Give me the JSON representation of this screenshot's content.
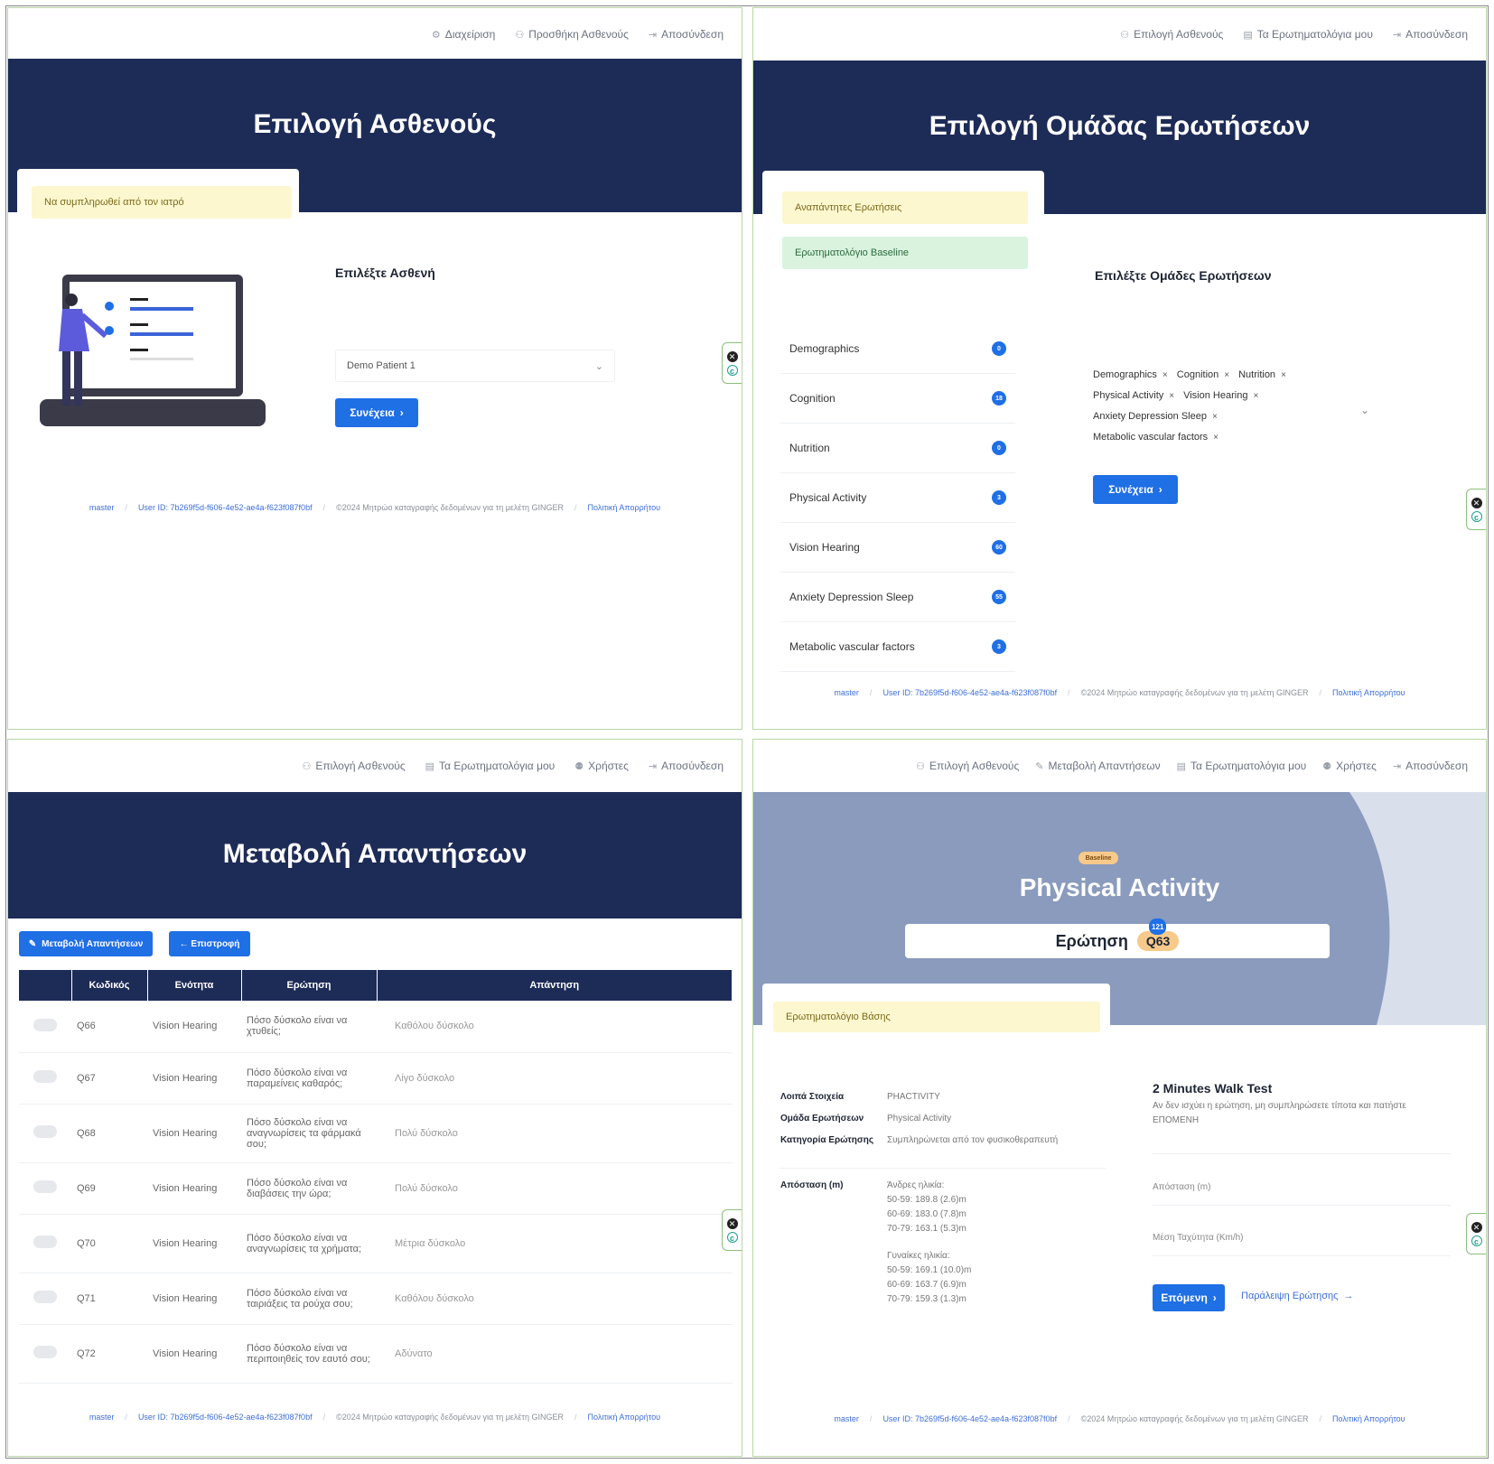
{
  "panel1": {
    "nav": [
      "Διαχείριση",
      "Προσθήκη Ασθενούς",
      "Αποσύνδεση"
    ],
    "title": "Επιλογή Ασθενούς",
    "note": "Να συμπληρωθεί από τον ιατρό",
    "label": "Επιλέξτε Ασθενή",
    "select_value": "Demo Patient 1",
    "button": "Συνέχεια",
    "footer": {
      "branch": "master",
      "user": "User ID: 7b269f5d-f606-4e52-ae4a-f623f087f0bf",
      "copy": "©2024 Μητρώο καταγραφής δεδομένων για τη μελέτη GINGER",
      "policy": "Πολιτική Απορρήτου"
    }
  },
  "panel2": {
    "nav": [
      "Επιλογή Ασθενούς",
      "Τα Ερωτηματολόγια μου",
      "Αποσύνδεση"
    ],
    "title": "Επιλογή Ομάδας Ερωτήσεων",
    "note_yellow": "Αναπάντητες Ερωτήσεις",
    "note_green": "Ερωτηματολόγιο Baseline",
    "groups": [
      {
        "name": "Demographics",
        "count": "0"
      },
      {
        "name": "Cognition",
        "count": "18"
      },
      {
        "name": "Nutrition",
        "count": "0"
      },
      {
        "name": "Physical Activity",
        "count": "3"
      },
      {
        "name": "Vision Hearing",
        "count": "60"
      },
      {
        "name": "Anxiety Depression Sleep",
        "count": "55"
      },
      {
        "name": "Metabolic vascular factors",
        "count": "3"
      }
    ],
    "label": "Επιλέξτε Ομάδες Ερωτήσεων",
    "tags": [
      "Demographics",
      "Cognition",
      "Nutrition",
      "Physical Activity",
      "Vision Hearing",
      "Anxiety Depression Sleep",
      "Metabolic vascular factors"
    ],
    "button": "Συνέχεια",
    "footer": {
      "branch": "master",
      "user": "User ID: 7b269f5d-f606-4e52-ae4a-f623f087f0bf",
      "copy": "©2024 Μητρώο καταγραφής δεδομένων για τη μελέτη GINGER",
      "policy": "Πολιτική Απορρήτου"
    }
  },
  "panel3": {
    "nav": [
      "Επιλογή Ασθενούς",
      "Τα Ερωτηματολόγια μου",
      "Χρήστες",
      "Αποσύνδεση"
    ],
    "title": "Μεταβολή Απαντήσεων",
    "btn_edit": "Μεταβολή Απαντήσεων",
    "btn_back": "← Επιστροφή",
    "columns": [
      "",
      "Κωδικός",
      "Ενότητα",
      "Ερώτηση",
      "Απάντηση"
    ],
    "rows": [
      {
        "code": "Q66",
        "section": "Vision Hearing",
        "question": "Πόσο δύσκολο είναι να χτυθείς;",
        "answer": "Καθόλου δύσκολο"
      },
      {
        "code": "Q67",
        "section": "Vision Hearing",
        "question": "Πόσο δύσκολο είναι να παραμείνεις καθαρός;",
        "answer": "Λίγο δύσκολο"
      },
      {
        "code": "Q68",
        "section": "Vision Hearing",
        "question": "Πόσο δύσκολο είναι να αναγνωρίσεις τα φάρμακά σου;",
        "answer": "Πολύ δύσκολο"
      },
      {
        "code": "Q69",
        "section": "Vision Hearing",
        "question": "Πόσο δύσκολο είναι να διαβάσεις την ώρα;",
        "answer": "Πολύ δύσκολο"
      },
      {
        "code": "Q70",
        "section": "Vision Hearing",
        "question": "Πόσο δύσκολο είναι να αναγνωρίσεις τα χρήματα;",
        "answer": "Μέτρια δύσκολο"
      },
      {
        "code": "Q71",
        "section": "Vision Hearing",
        "question": "Πόσο δύσκολο είναι να ταιριάξεις τα ρούχα σου;",
        "answer": "Καθόλου δύσκολο"
      },
      {
        "code": "Q72",
        "section": "Vision Hearing",
        "question": "Πόσο δύσκολο είναι να περιποιηθείς τον εαυτό σου;",
        "answer": "Αδύνατο"
      }
    ],
    "footer": {
      "branch": "master",
      "user": "User ID: 7b269f5d-f606-4e52-ae4a-f623f087f0bf",
      "copy": "©2024 Μητρώο καταγραφής δεδομένων για τη μελέτη GINGER",
      "policy": "Πολιτική Απορρήτου"
    }
  },
  "panel4": {
    "nav": [
      "Επιλογή Ασθενούς",
      "Μεταβολή Απαντήσεων",
      "Τα Ερωτηματολόγια μου",
      "Χρήστες",
      "Αποσύνδεση"
    ],
    "pill": "Baseline",
    "title": "Physical Activity",
    "question_label": "Ερώτηση",
    "question_code": "Q63",
    "question_count": "121",
    "note": "Ερωτηματολόγιο Βάσης",
    "details": {
      "k1": "Λοιπά Στοιχεία",
      "v1": "PHACTIVITY",
      "k2": "Ομάδα Ερωτήσεων",
      "v2": "Physical Activity",
      "k3": "Κατηγορία Ερώτησης",
      "v3": "Συμπληρώνεται από τον φυσικοθεραπευτή"
    },
    "dist_label": "Απόσταση (m)",
    "men_label": "Άνδρες ηλικία:",
    "men": [
      "50-59: 189.8 (2.6)m",
      "60-69: 183.0 (7.8)m",
      "70-79: 163.1 (5.3)m"
    ],
    "women_label": "Γυναίκες ηλικία:",
    "women": [
      "50-59: 169.1 (10.0)m",
      "60-69: 163.7 (6.9)m",
      "70-79: 159.3 (1.3)m"
    ],
    "test_title": "2 Minutes Walk Test",
    "test_desc": "Αν δεν ισχύει η ερώτηση, μη συμπληρώσετε τίποτα και πατήστε ΕΠΟΜΕΝΗ",
    "field1": "Απόσταση (m)",
    "field2": "Μέση Ταχύτητα (Km/h)",
    "btn_next": "Επόμενη",
    "skip": "Παράλειψη Ερώτησης",
    "footer": {
      "branch": "master",
      "user": "User ID: 7b269f5d-f606-4e52-ae4a-f623f087f0bf",
      "copy": "©2024 Μητρώο καταγραφής δεδομένων για τη μελέτη GINGER",
      "policy": "Πολιτική Απορρήτου"
    }
  }
}
